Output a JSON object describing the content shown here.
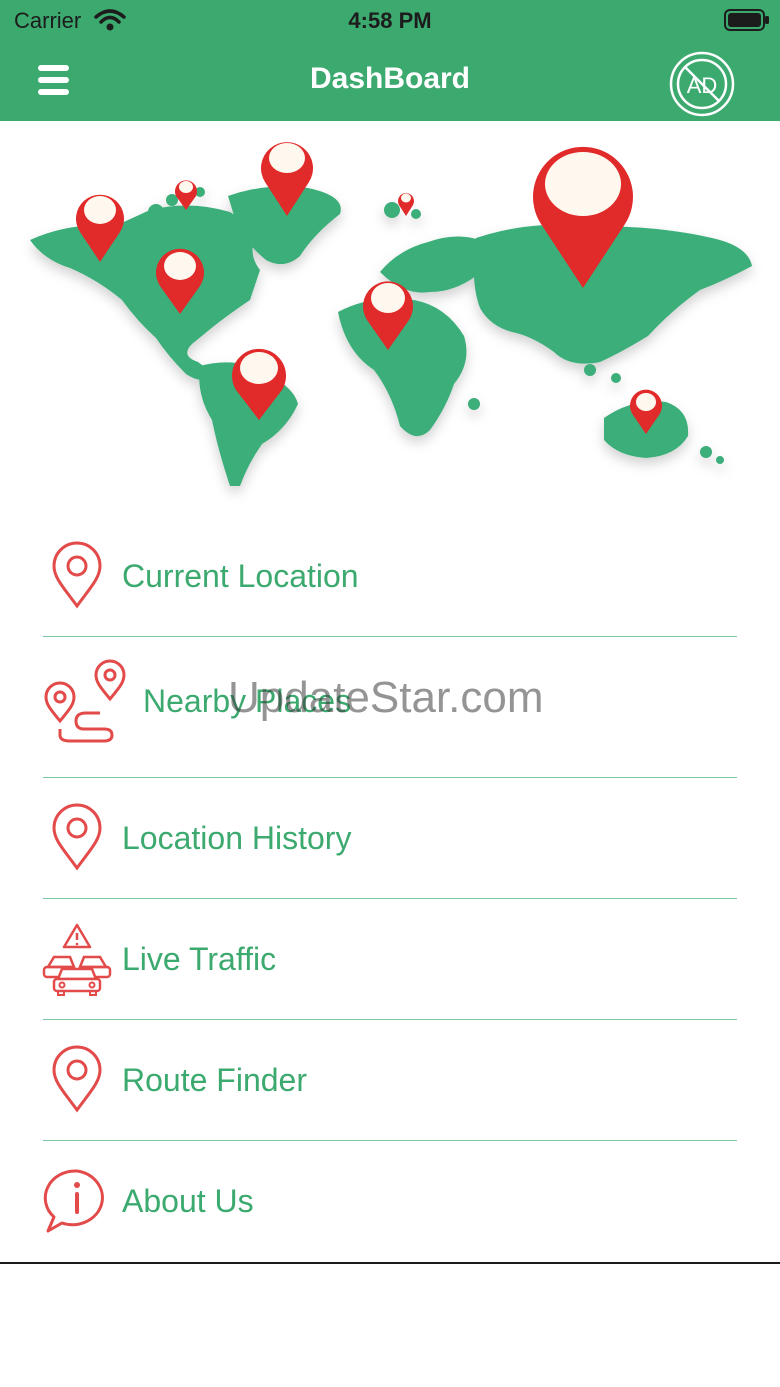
{
  "status_bar": {
    "carrier": "Carrier",
    "time": "4:58 PM"
  },
  "nav": {
    "title": "DashBoard",
    "ad_label": "AD"
  },
  "menu": {
    "items": [
      {
        "label": "Current Location",
        "icon": "location-pin-icon"
      },
      {
        "label": "Nearby Places",
        "icon": "route-pins-icon"
      },
      {
        "label": "Location History",
        "icon": "location-pin-icon"
      },
      {
        "label": "Live Traffic",
        "icon": "traffic-cars-icon"
      },
      {
        "label": "Route Finder",
        "icon": "location-pin-icon"
      },
      {
        "label": "About Us",
        "icon": "info-bubble-icon"
      }
    ]
  },
  "watermark": "UpdateStar.com",
  "colors": {
    "brand_green": "#3ca96f",
    "pin_red": "#e12a2a",
    "icon_red": "#e34a4a"
  }
}
